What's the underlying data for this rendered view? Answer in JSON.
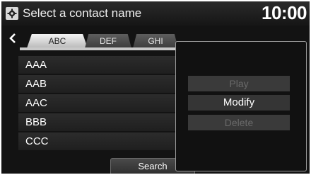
{
  "header": {
    "title": "Select a contact name",
    "clock": "10:00",
    "icon": "settings-icon"
  },
  "tabs": [
    {
      "label": "ABC",
      "active": true
    },
    {
      "label": "DEF",
      "active": false
    },
    {
      "label": "GHI",
      "active": false
    }
  ],
  "contacts": [
    "AAA",
    "AAB",
    "AAC",
    "BBB",
    "CCC"
  ],
  "search_label": "Search",
  "popup": {
    "play": "Play",
    "modify": "Modify",
    "delete": "Delete"
  }
}
